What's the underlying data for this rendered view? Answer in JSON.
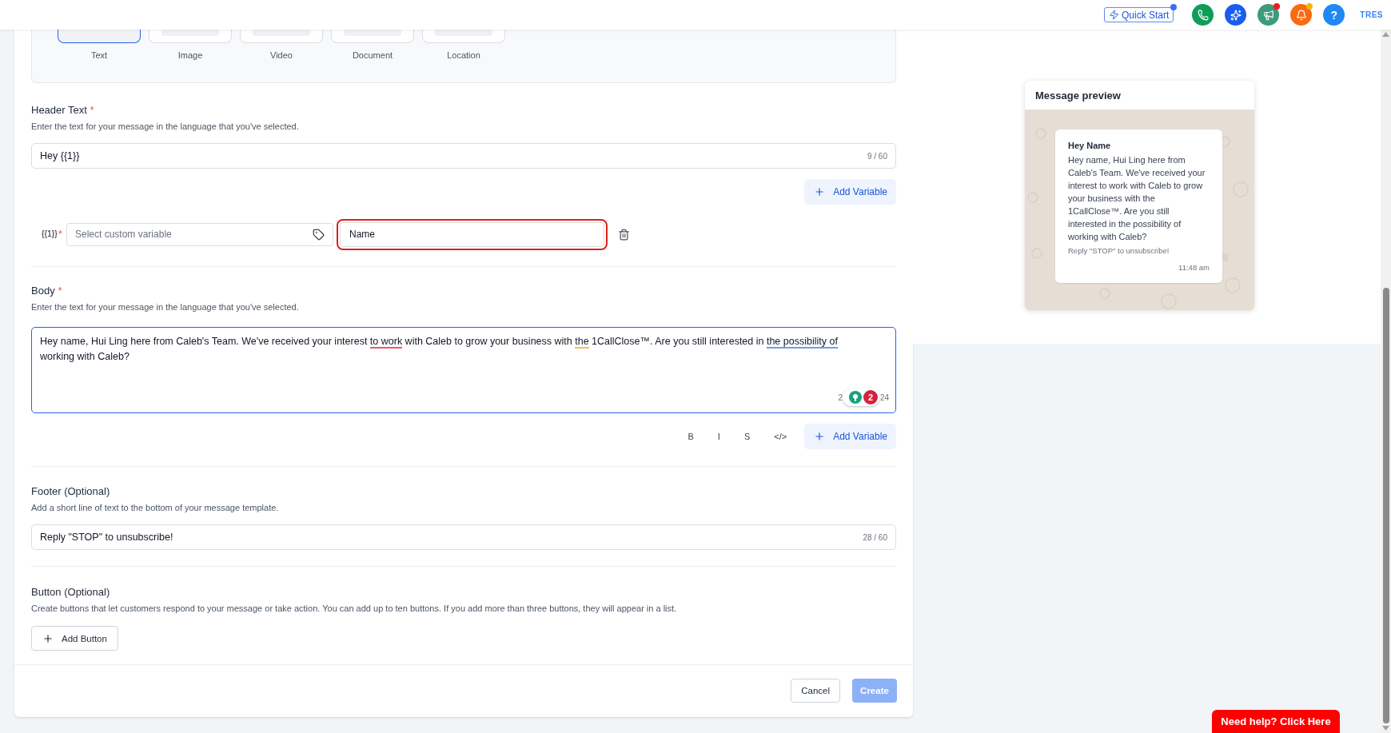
{
  "topbar": {
    "quick_start": "Quick Start",
    "quick_start_alert": true,
    "icons": [
      {
        "kind": "phone",
        "color": "#0f9d58",
        "alert": false
      },
      {
        "kind": "sparkles",
        "color": "#1a5cf0",
        "alert": false
      },
      {
        "kind": "megaphone",
        "color": "#3f9a78",
        "alert": true
      },
      {
        "kind": "bell",
        "color": "#fb6a10",
        "alert": true
      }
    ],
    "help": "?",
    "user": "TRES"
  },
  "media_types": [
    {
      "label": "Text",
      "selected": true
    },
    {
      "label": "Image",
      "selected": false
    },
    {
      "label": "Video",
      "selected": false
    },
    {
      "label": "Document",
      "selected": false
    },
    {
      "label": "Location",
      "selected": false
    }
  ],
  "header_text": {
    "label": "Header Text",
    "required_mark": "*",
    "description": "Enter the text for your message in the language that you've selected.",
    "value": "Hey {{1}}",
    "counter": "9 / 60",
    "add_variable": "Add Variable"
  },
  "variables": [
    {
      "token": "{{1}}",
      "required_mark": "*",
      "placeholder": "Select custom variable",
      "value": "Name",
      "highlighted": true
    }
  ],
  "body": {
    "label": "Body",
    "required_mark": "*",
    "description": "Enter the text for your message in the language that you've selected.",
    "segments": [
      {
        "text": "Hey name, Hui Ling here from Caleb's Team. We've received your interest "
      },
      {
        "text": "to work",
        "color": "#e8566f"
      },
      {
        "text": " with Caleb to grow your business with "
      },
      {
        "text": "the",
        "color": "#f0c24b"
      },
      {
        "text": " 1CallClose™. Are you still interested in "
      },
      {
        "text": "the possibility of",
        "color": "#6d9ee8"
      },
      {
        "text": " working with Caleb?"
      }
    ],
    "counter_start": "2",
    "counter_end": "24",
    "grammar_count": "2",
    "format_buttons": [
      "B",
      "I",
      "S",
      "</>"
    ],
    "add_variable": "Add Variable"
  },
  "footer": {
    "label": "Footer (Optional)",
    "description": "Add a short line of text to the bottom of your message template.",
    "value": "Reply \"STOP\" to unsubscribe!",
    "counter": "28 / 60"
  },
  "buttons_section": {
    "label": "Button (Optional)",
    "description": "Create buttons that let customers respond to your message or take action. You can add up to ten buttons. If you add more than three buttons, they will appear in a list.",
    "add_button": "Add Button"
  },
  "actions": {
    "cancel": "Cancel",
    "create": "Create",
    "create_disabled": true
  },
  "preview": {
    "title": "Message preview",
    "header": "Hey Name",
    "body": "Hey name, Hui Ling here from Caleb's Team. We've received your interest to work with Caleb to grow your business with the 1CallClose™. Are you still interested in the possibility of working with Caleb?",
    "footer": "Reply \"STOP\" to unsubscribe!",
    "time": "11:48 am"
  },
  "help_button": "Need help? Click Here"
}
